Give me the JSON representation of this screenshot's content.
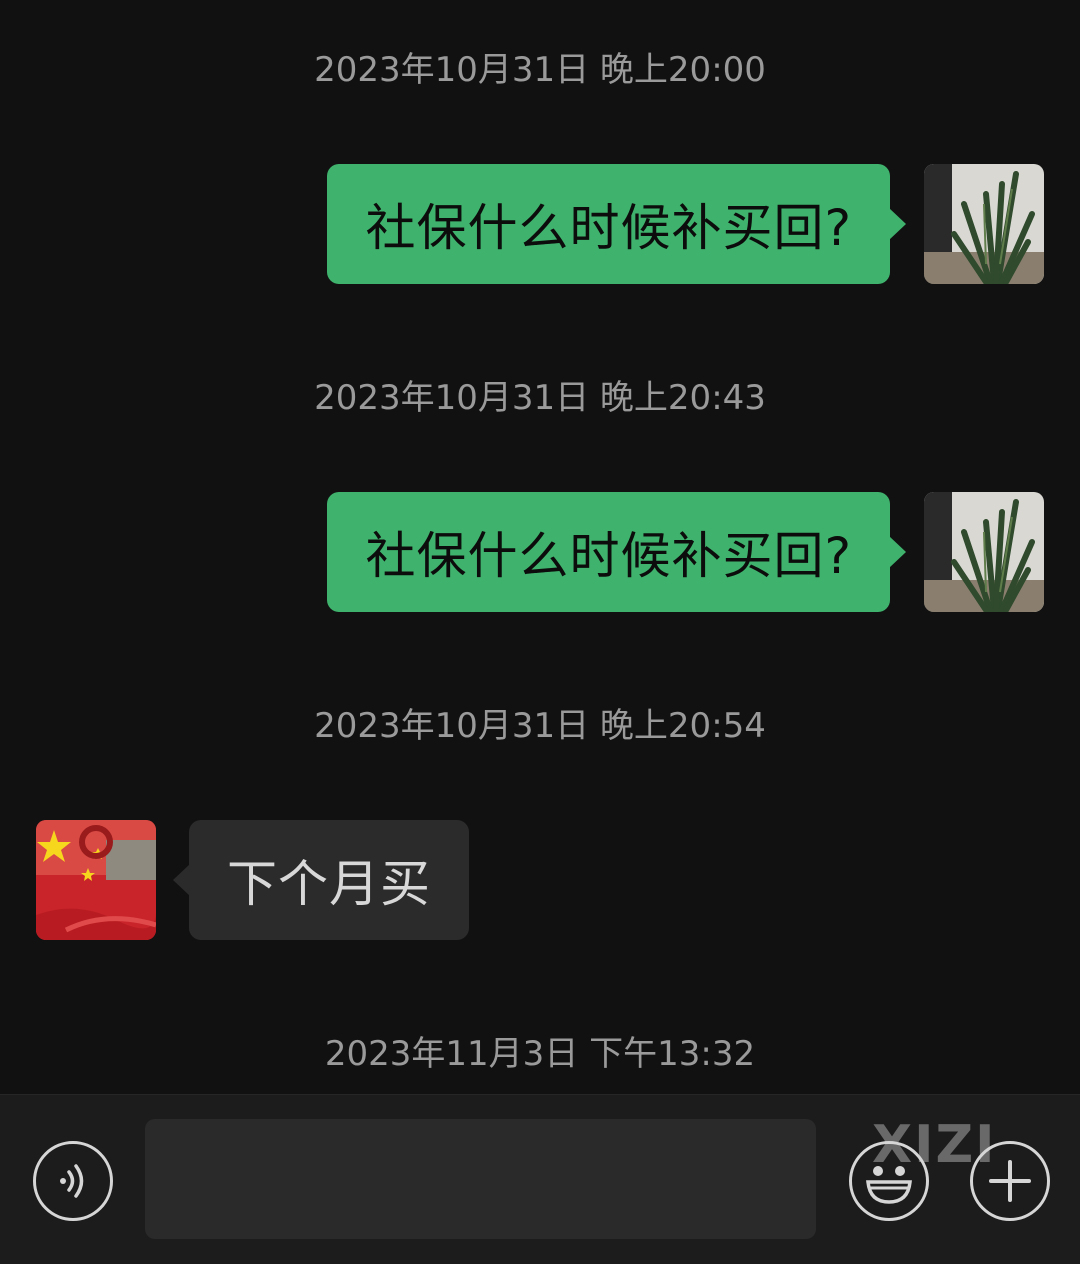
{
  "messages": [
    {
      "timestamp": "2023年10月31日 晚上20:00",
      "sender": "me",
      "text": "社保什么时候补买回?"
    },
    {
      "timestamp": "2023年10月31日 晚上20:43",
      "sender": "me",
      "text": "社保什么时候补买回?"
    },
    {
      "timestamp": "2023年10月31日 晚上20:54",
      "sender": "other",
      "text": "下个月买"
    }
  ],
  "last_timestamp": "2023年11月3日 下午13:32",
  "input": {
    "value": "",
    "placeholder": ""
  },
  "watermark": "XIZI",
  "icons": {
    "voice": "voice-icon",
    "emoji": "emoji-icon",
    "more": "plus-icon"
  },
  "colors": {
    "outgoing_bubble": "#3fb36d",
    "incoming_bubble": "#2b2b2b",
    "background": "#111111"
  }
}
